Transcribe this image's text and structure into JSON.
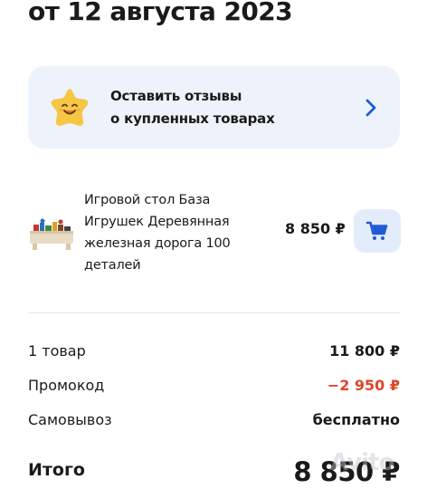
{
  "header": {
    "title": "от 12 августа 2023"
  },
  "review_prompt": {
    "line1": "Оставить отзывы",
    "line2": "о купленных товарах",
    "icon": "smiling-star-icon",
    "arrow_icon": "chevron-right-icon",
    "colors": {
      "card_bg": "#eef3fb",
      "star": "#f6c744",
      "arrow": "#1f5bd8"
    }
  },
  "product": {
    "name": "Игровой стол База Игрушек Деревянная железная дорога 100 деталей",
    "price": "8 850 ₽",
    "cart_icon": "cart-icon",
    "colors": {
      "cart_bg": "#e3ecfb",
      "cart_icon": "#1f5bd8"
    }
  },
  "summary": {
    "items_label": "1 товар",
    "items_value": "11 800 ₽",
    "promo_label": "Промокод",
    "promo_value": "−2 950 ₽",
    "pickup_label": "Самовывоз",
    "pickup_value": "бесплатно",
    "total_label": "Итого",
    "total_value": "8 850 ₽",
    "colors": {
      "discount": "#e0452b"
    }
  },
  "watermark": {
    "text": "Avito"
  }
}
